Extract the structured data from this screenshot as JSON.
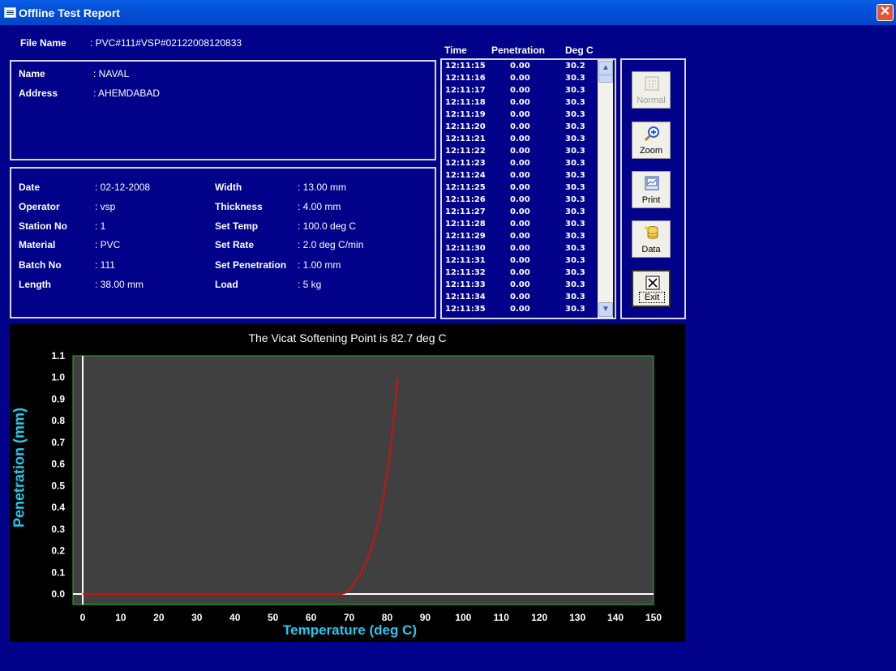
{
  "window": {
    "title": "Offline Test Report",
    "close_glyph": "✕"
  },
  "file": {
    "label": "File Name",
    "value": ": PVC#111#VSP#02122008120833"
  },
  "customer": {
    "name_label": "Name",
    "name_value": ": NAVAL",
    "address_label": "Address",
    "address_value": ": AHEMDABAD"
  },
  "details": {
    "left": [
      {
        "label": "Date",
        "value": ": 02-12-2008"
      },
      {
        "label": "Operator",
        "value": ": vsp"
      },
      {
        "label": "Station No",
        "value": ": 1"
      },
      {
        "label": "Material",
        "value": ": PVC"
      },
      {
        "label": "Batch No",
        "value": ": 111"
      },
      {
        "label": "Length",
        "value": ": 38.00  mm"
      }
    ],
    "right": [
      {
        "label": "Width",
        "value": ": 13.00  mm"
      },
      {
        "label": "Thickness",
        "value": ": 4.00  mm"
      },
      {
        "label": "Set Temp",
        "value": ": 100.0  deg C"
      },
      {
        "label": "Set Rate",
        "value": ": 2.0  deg C/min"
      },
      {
        "label": "Set Penetration",
        "value": ": 1.00  mm"
      },
      {
        "label": "Load",
        "value": ": 5  kg"
      }
    ]
  },
  "readings": {
    "headers": {
      "time": "Time",
      "penetration": "Penetration",
      "degc": "Deg C"
    },
    "rows": [
      {
        "time": "12:11:15",
        "penetration": "0.00",
        "degc": "30.2"
      },
      {
        "time": "12:11:16",
        "penetration": "0.00",
        "degc": "30.3"
      },
      {
        "time": "12:11:17",
        "penetration": "0.00",
        "degc": "30.3"
      },
      {
        "time": "12:11:18",
        "penetration": "0.00",
        "degc": "30.3"
      },
      {
        "time": "12:11:19",
        "penetration": "0.00",
        "degc": "30.3"
      },
      {
        "time": "12:11:20",
        "penetration": "0.00",
        "degc": "30.3"
      },
      {
        "time": "12:11:21",
        "penetration": "0.00",
        "degc": "30.3"
      },
      {
        "time": "12:11:22",
        "penetration": "0.00",
        "degc": "30.3"
      },
      {
        "time": "12:11:23",
        "penetration": "0.00",
        "degc": "30.3"
      },
      {
        "time": "12:11:24",
        "penetration": "0.00",
        "degc": "30.3"
      },
      {
        "time": "12:11:25",
        "penetration": "0.00",
        "degc": "30.3"
      },
      {
        "time": "12:11:26",
        "penetration": "0.00",
        "degc": "30.3"
      },
      {
        "time": "12:11:27",
        "penetration": "0.00",
        "degc": "30.3"
      },
      {
        "time": "12:11:28",
        "penetration": "0.00",
        "degc": "30.3"
      },
      {
        "time": "12:11:29",
        "penetration": "0.00",
        "degc": "30.3"
      },
      {
        "time": "12:11:30",
        "penetration": "0.00",
        "degc": "30.3"
      },
      {
        "time": "12:11:31",
        "penetration": "0.00",
        "degc": "30.3"
      },
      {
        "time": "12:11:32",
        "penetration": "0.00",
        "degc": "30.3"
      },
      {
        "time": "12:11:33",
        "penetration": "0.00",
        "degc": "30.3"
      },
      {
        "time": "12:11:34",
        "penetration": "0.00",
        "degc": "30.3"
      },
      {
        "time": "12:11:35",
        "penetration": "0.00",
        "degc": "30.3"
      }
    ]
  },
  "toolbar": {
    "normal": {
      "label": "Normal",
      "icon": "grid-icon",
      "enabled": false
    },
    "zoom": {
      "label": "Zoom",
      "icon": "magnifier-plus-icon"
    },
    "print": {
      "label": "Print",
      "icon": "printer-icon"
    },
    "data": {
      "label": "Data",
      "icon": "database-icon"
    },
    "exit": {
      "label": "Exit",
      "icon": "close-box-icon"
    }
  },
  "chart_data": {
    "type": "line",
    "title": "The Vicat Softening Point is 82.7 deg C",
    "xlabel": "Temperature (deg C)",
    "ylabel": "Penetration (mm)",
    "xlim": [
      0,
      150
    ],
    "ylim": [
      0,
      1.1
    ],
    "xticks": [
      "0",
      "10",
      "20",
      "30",
      "40",
      "50",
      "60",
      "70",
      "80",
      "90",
      "100",
      "110",
      "120",
      "130",
      "140",
      "150"
    ],
    "yticks": [
      "0.0",
      "0.1",
      "0.2",
      "0.3",
      "0.4",
      "0.5",
      "0.6",
      "0.7",
      "0.8",
      "0.9",
      "1.0",
      "1.1"
    ],
    "series": [
      {
        "color": "#d01010",
        "x": [
          0,
          68,
          69,
          70,
          71,
          72,
          73,
          74,
          75,
          76,
          77,
          78,
          79,
          80,
          81,
          82,
          82.7
        ],
        "y": [
          0,
          0,
          0.005,
          0.02,
          0.04,
          0.065,
          0.095,
          0.13,
          0.17,
          0.22,
          0.28,
          0.36,
          0.45,
          0.56,
          0.69,
          0.85,
          1.0
        ]
      }
    ],
    "colors": {
      "plot_bg": "#404040",
      "frame": "#22bb22",
      "axis_line": "#ffffff",
      "label": "#27c8f0"
    }
  }
}
